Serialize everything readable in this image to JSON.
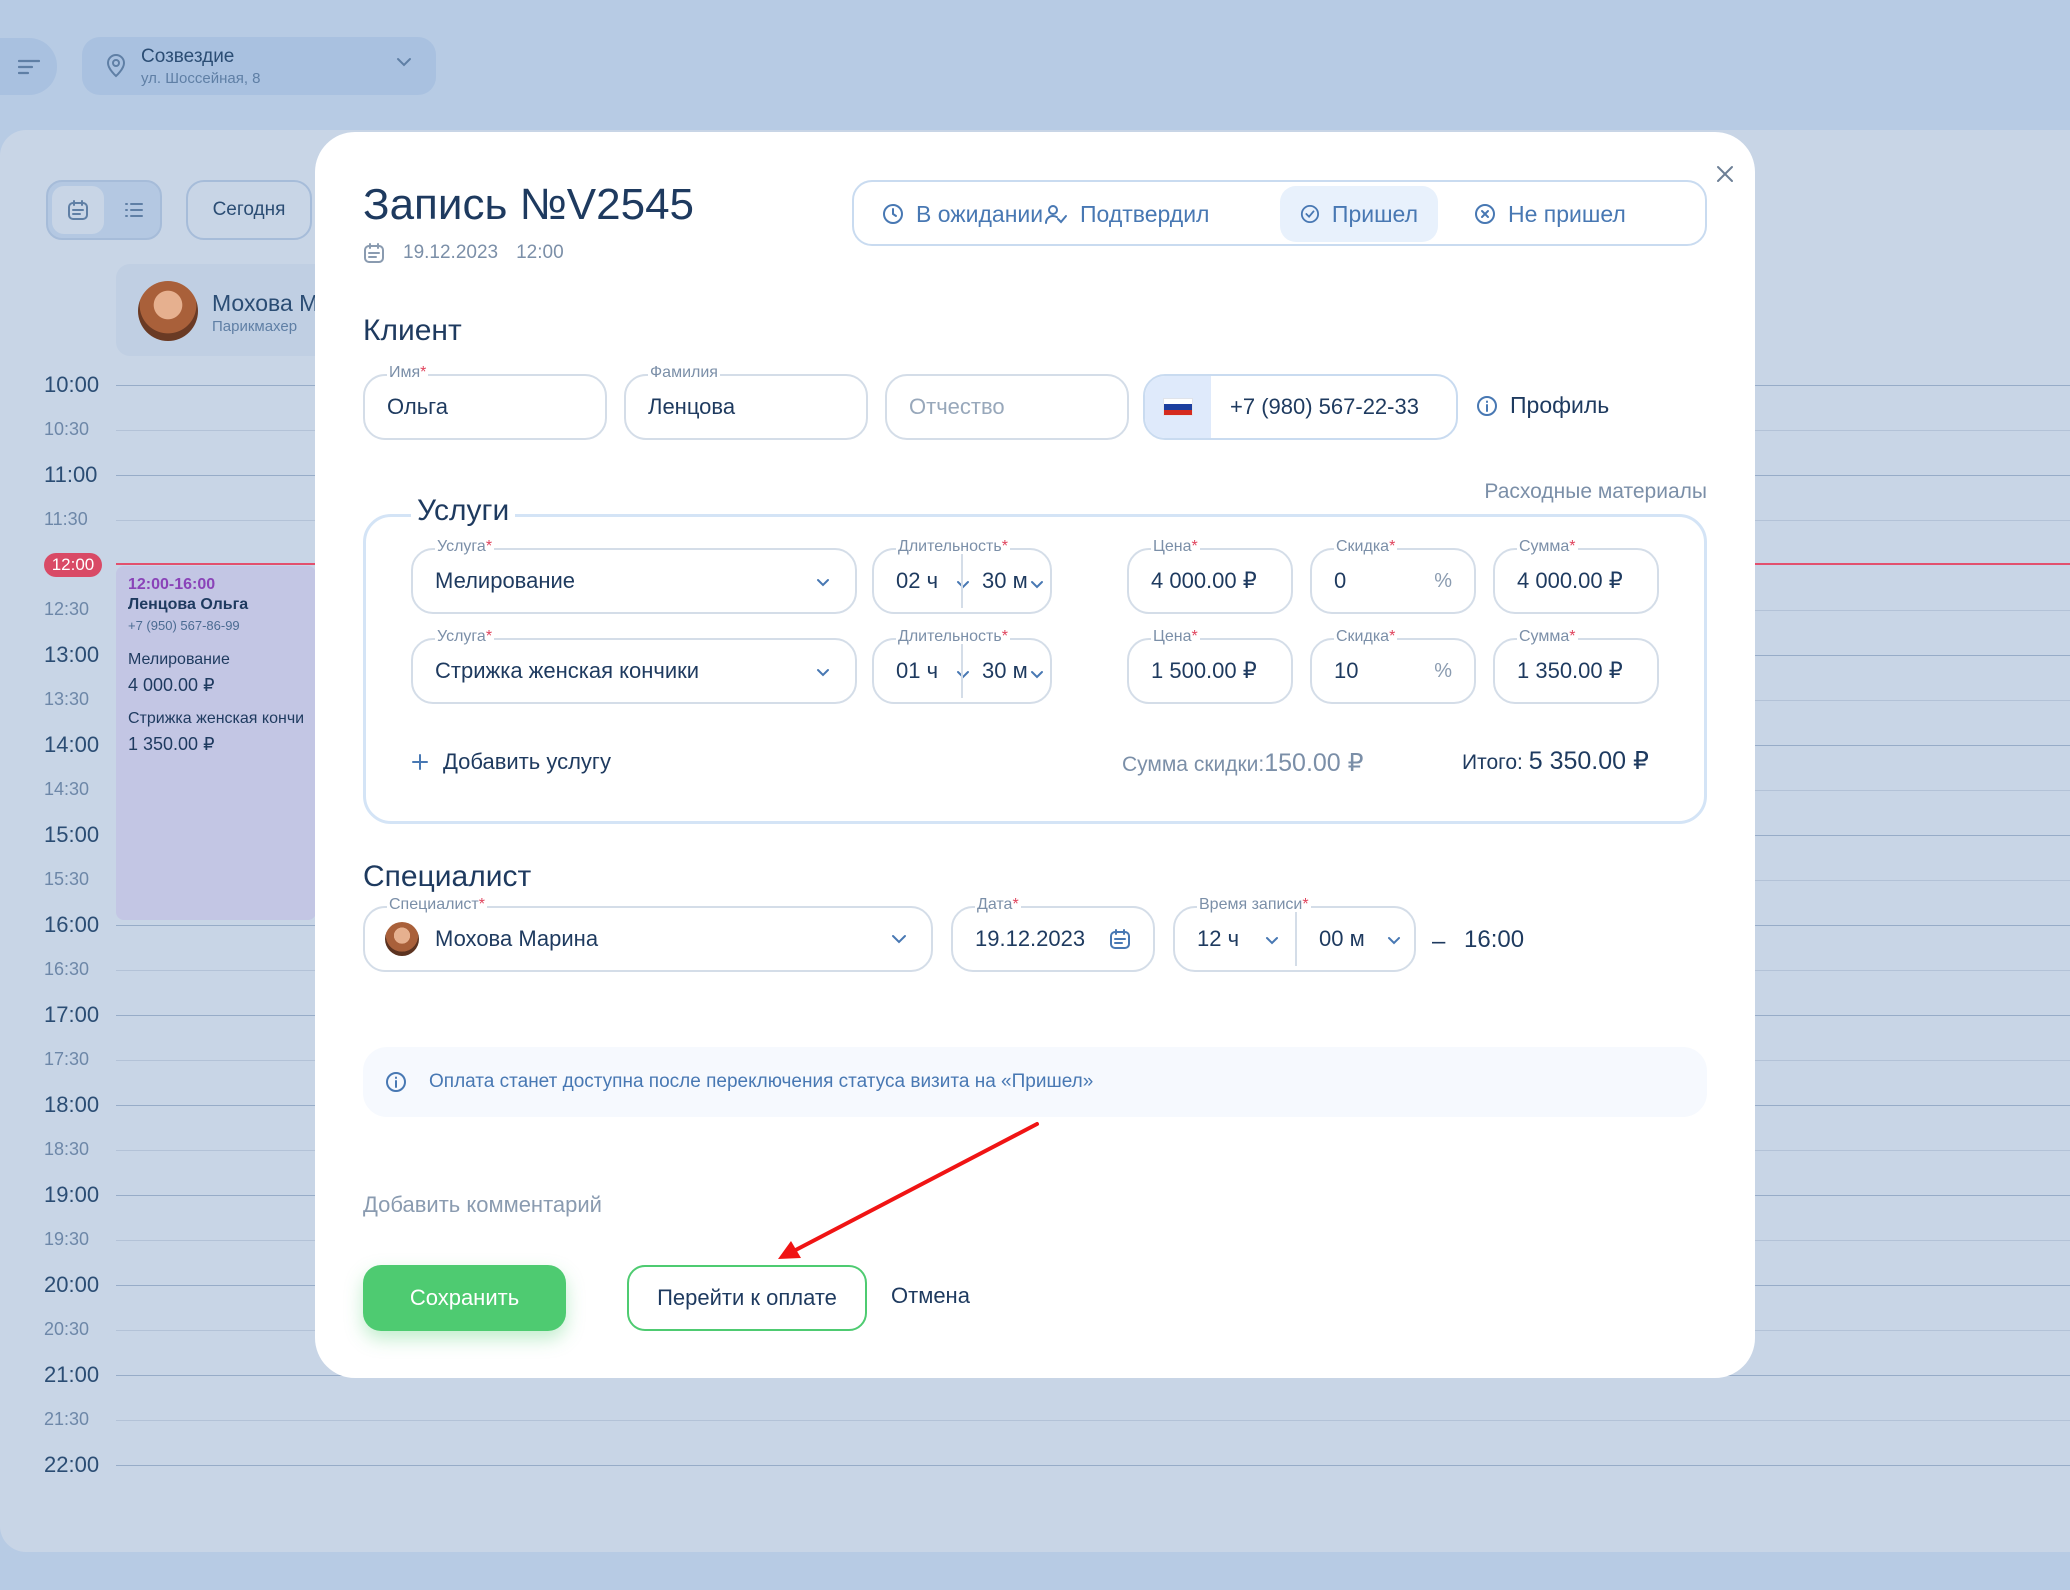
{
  "location": {
    "name": "Созвездие",
    "address": "ул. Шоссейная, 8"
  },
  "toolbar": {
    "today_label": "Сегодня"
  },
  "specialist_card": {
    "name": "Мохова М",
    "role": "Парикмахер"
  },
  "timeline": {
    "hours": [
      "10:00",
      "11:00",
      "12:00",
      "13:00",
      "14:00",
      "15:00",
      "16:00",
      "17:00",
      "18:00",
      "19:00",
      "20:00",
      "21:00",
      "22:00"
    ],
    "halves": [
      "10:30",
      "11:30",
      "12:30",
      "13:30",
      "14:30",
      "15:30",
      "16:30",
      "17:30",
      "18:30",
      "19:30",
      "20:30",
      "21:30"
    ],
    "now": "12:00"
  },
  "event": {
    "time": "12:00-16:00",
    "client": "Ленцова Ольга",
    "phone": "+7 (950) 567-86-99",
    "service1": "Мелирование",
    "price1": "4 000.00 ₽",
    "service2": "Стрижка женская кончи",
    "price2": "1 350.00 ₽"
  },
  "modal": {
    "title": "Запись №V2545",
    "date": "19.12.2023",
    "time": "12:00",
    "statuses": [
      "В ожидании",
      "Подтвердил",
      "Пришел",
      "Не пришел"
    ],
    "active_status": "Пришел",
    "client": {
      "section_title": "Клиент",
      "first_name_label": "Имя",
      "first_name": "Ольга",
      "last_name_label": "Фамилия",
      "last_name": "Ленцова",
      "middle_name_placeholder": "Отчество",
      "phone": "+7 (980) 567-22-33",
      "profile_label": "Профиль"
    },
    "services": {
      "section_title": "Услуги",
      "materials_link": "Расходные материалы",
      "labels": {
        "service": "Услуга",
        "duration": "Длительность",
        "price": "Цена",
        "discount": "Скидка",
        "sum": "Сумма"
      },
      "rows": [
        {
          "service": "Мелирование",
          "hours": "02 ч",
          "minutes": "30 м",
          "price": "4 000.00 ₽",
          "discount": "0",
          "discount_unit": "%",
          "sum": "4 000.00 ₽"
        },
        {
          "service": "Стрижка женская кончики",
          "hours": "01 ч",
          "minutes": "30 м",
          "price": "1 500.00 ₽",
          "discount": "10",
          "discount_unit": "%",
          "sum": "1 350.00 ₽"
        }
      ],
      "add_label": "Добавить услугу",
      "discount_sum_label": "Сумма скидки:",
      "discount_sum": "150.00 ₽",
      "total_label": "Итого:",
      "total": "5 350.00 ₽"
    },
    "specialist": {
      "section_title": "Специалист",
      "specialist_label": "Специалист",
      "specialist_name": "Мохова Марина",
      "date_label": "Дата",
      "date": "19.12.2023",
      "time_label": "Время записи",
      "hours": "12 ч",
      "minutes": "00 м",
      "dash": "–",
      "end_time": "16:00"
    },
    "info_text": "Оплата станет доступна после переключения статуса визита на «Пришел»",
    "add_comment": "Добавить комментарий",
    "buttons": {
      "save": "Сохранить",
      "pay": "Перейти к оплате",
      "cancel": "Отмена"
    }
  },
  "colors": {
    "accent_green": "#4ecb71",
    "status_blue": "#4878b3",
    "required_red": "#e0445d",
    "now_red": "#d94a66"
  }
}
